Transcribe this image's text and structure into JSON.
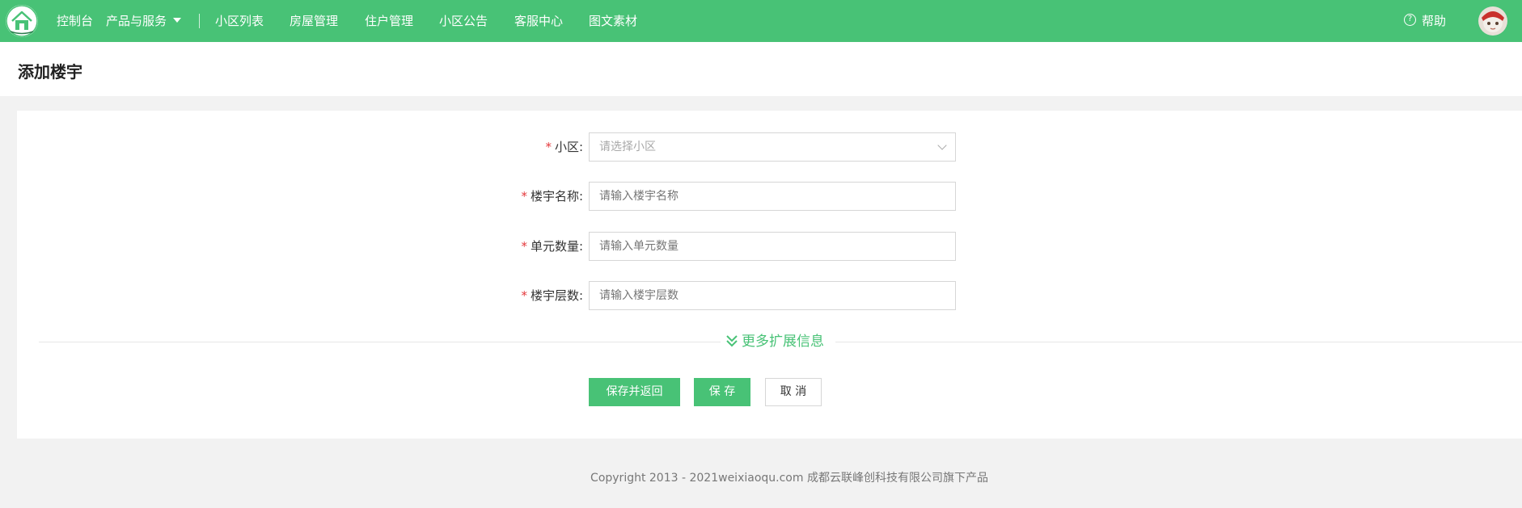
{
  "colors": {
    "brand_green": "#48c276",
    "required_red": "#e4393c",
    "page_bg": "#f2f2f2"
  },
  "header": {
    "logo_icon": "house-logo-icon",
    "nav": [
      {
        "label": "控制台"
      },
      {
        "label": "产品与服务",
        "has_dropdown": true
      },
      {
        "label": "小区列表"
      },
      {
        "label": "房屋管理"
      },
      {
        "label": "住户管理"
      },
      {
        "label": "小区公告"
      },
      {
        "label": "客服中心"
      },
      {
        "label": "图文素材"
      }
    ],
    "help_label": "帮助",
    "help_icon": "question-circle-icon",
    "avatar_icon": "user-avatar"
  },
  "page": {
    "title": "添加楼宇"
  },
  "form": {
    "fields": [
      {
        "required_mark": "*",
        "label": "小区:",
        "type": "select",
        "placeholder": "请选择小区",
        "value": ""
      },
      {
        "required_mark": "*",
        "label": "楼宇名称:",
        "type": "text",
        "placeholder": "请输入楼宇名称",
        "value": ""
      },
      {
        "required_mark": "*",
        "label": "单元数量:",
        "type": "text",
        "placeholder": "请输入单元数量",
        "value": ""
      },
      {
        "required_mark": "*",
        "label": "楼宇层数:",
        "type": "text",
        "placeholder": "请输入楼宇层数",
        "value": ""
      }
    ],
    "more_label": "更多扩展信息",
    "more_icon": "double-chevron-down-icon",
    "buttons": {
      "save_and_return": "保存并返回",
      "save": "保 存",
      "cancel": "取 消"
    }
  },
  "footer": {
    "text": "Copyright 2013 - 2021weixiaoqu.com 成都云联峰创科技有限公司旗下产品"
  }
}
